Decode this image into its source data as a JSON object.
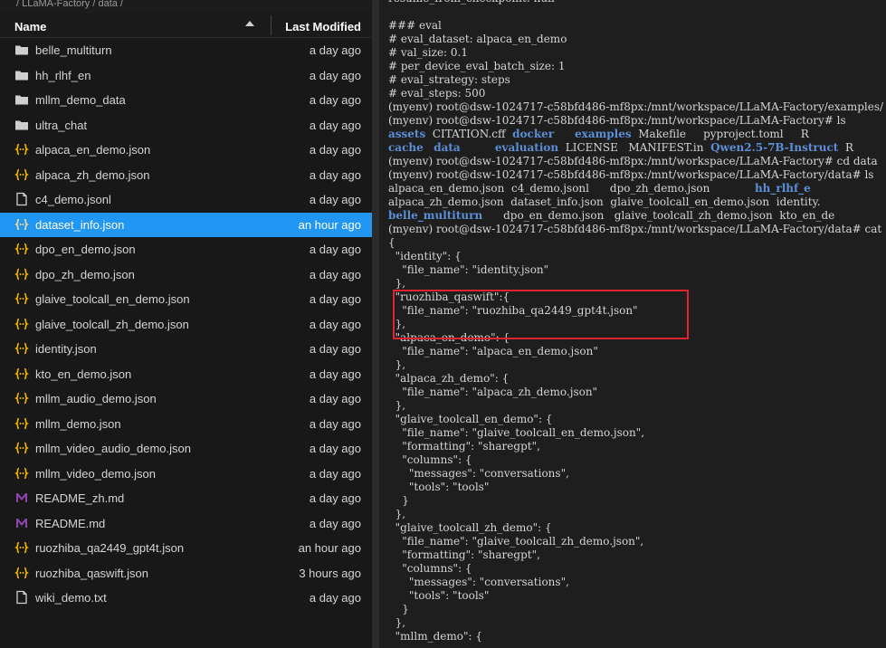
{
  "explorer": {
    "breadcrumb": "/ LLaMA-Factory / data /",
    "columns": {
      "name": "Name",
      "modified": "Last Modified"
    },
    "files": [
      {
        "name": "belle_multiturn",
        "modified": "a day ago",
        "icon": "folder-icon",
        "type": "folder"
      },
      {
        "name": "hh_rlhf_en",
        "modified": "a day ago",
        "icon": "folder-icon",
        "type": "folder"
      },
      {
        "name": "mllm_demo_data",
        "modified": "a day ago",
        "icon": "folder-icon",
        "type": "folder"
      },
      {
        "name": "ultra_chat",
        "modified": "a day ago",
        "icon": "folder-icon",
        "type": "folder"
      },
      {
        "name": "alpaca_en_demo.json",
        "modified": "a day ago",
        "icon": "json-icon",
        "type": "json"
      },
      {
        "name": "alpaca_zh_demo.json",
        "modified": "a day ago",
        "icon": "json-icon",
        "type": "json"
      },
      {
        "name": "c4_demo.jsonl",
        "modified": "a day ago",
        "icon": "file-icon",
        "type": "file"
      },
      {
        "name": "dataset_info.json",
        "modified": "an hour ago",
        "icon": "json-icon",
        "type": "json",
        "selected": true
      },
      {
        "name": "dpo_en_demo.json",
        "modified": "a day ago",
        "icon": "json-icon",
        "type": "json"
      },
      {
        "name": "dpo_zh_demo.json",
        "modified": "a day ago",
        "icon": "json-icon",
        "type": "json"
      },
      {
        "name": "glaive_toolcall_en_demo.json",
        "modified": "a day ago",
        "icon": "json-icon",
        "type": "json"
      },
      {
        "name": "glaive_toolcall_zh_demo.json",
        "modified": "a day ago",
        "icon": "json-icon",
        "type": "json"
      },
      {
        "name": "identity.json",
        "modified": "a day ago",
        "icon": "json-icon",
        "type": "json"
      },
      {
        "name": "kto_en_demo.json",
        "modified": "a day ago",
        "icon": "json-icon",
        "type": "json"
      },
      {
        "name": "mllm_audio_demo.json",
        "modified": "a day ago",
        "icon": "json-icon",
        "type": "json"
      },
      {
        "name": "mllm_demo.json",
        "modified": "a day ago",
        "icon": "json-icon",
        "type": "json"
      },
      {
        "name": "mllm_video_audio_demo.json",
        "modified": "a day ago",
        "icon": "json-icon",
        "type": "json"
      },
      {
        "name": "mllm_video_demo.json",
        "modified": "a day ago",
        "icon": "json-icon",
        "type": "json"
      },
      {
        "name": "README_zh.md",
        "modified": "a day ago",
        "icon": "markdown-icon",
        "type": "markdown"
      },
      {
        "name": "README.md",
        "modified": "a day ago",
        "icon": "markdown-icon",
        "type": "markdown"
      },
      {
        "name": "ruozhiba_qa2449_gpt4t.json",
        "modified": "an hour ago",
        "icon": "json-icon",
        "type": "json"
      },
      {
        "name": "ruozhiba_qaswift.json",
        "modified": "3 hours ago",
        "icon": "json-icon",
        "type": "json"
      },
      {
        "name": "wiki_demo.txt",
        "modified": "a day ago",
        "icon": "file-icon",
        "type": "file"
      }
    ]
  },
  "terminal": {
    "lines": [
      [
        {
          "t": "resume_from_checkpoint: null"
        }
      ],
      [
        {
          "t": ""
        }
      ],
      [
        {
          "t": "### eval"
        }
      ],
      [
        {
          "t": "# eval_dataset: alpaca_en_demo"
        }
      ],
      [
        {
          "t": "# val_size: 0.1"
        }
      ],
      [
        {
          "t": "# per_device_eval_batch_size: 1"
        }
      ],
      [
        {
          "t": "# eval_strategy: steps"
        }
      ],
      [
        {
          "t": "# eval_steps: 500"
        }
      ],
      [
        {
          "t": "(myenv) root@dsw-1024717-c58bfd486-mf8px:/mnt/workspace/LLaMA-Factory/examples/"
        }
      ],
      [
        {
          "t": "(myenv) root@dsw-1024717-c58bfd486-mf8px:/mnt/workspace/LLaMA-Factory# ls"
        }
      ],
      [
        {
          "t": "assets",
          "c": "blue"
        },
        {
          "t": "  CITATION.cff  "
        },
        {
          "t": "docker",
          "c": "blue"
        },
        {
          "t": "      "
        },
        {
          "t": "examples",
          "c": "blue"
        },
        {
          "t": "  Makefile     pyproject.toml     R"
        }
      ],
      [
        {
          "t": "cache",
          "c": "blue"
        },
        {
          "t": "   "
        },
        {
          "t": "data",
          "c": "blue"
        },
        {
          "t": "          "
        },
        {
          "t": "evaluation",
          "c": "blue"
        },
        {
          "t": "  LICENSE   MANIFEST.in  "
        },
        {
          "t": "Qwen2.5-7B-Instruct",
          "c": "blue"
        },
        {
          "t": "  R"
        }
      ],
      [
        {
          "t": "(myenv) root@dsw-1024717-c58bfd486-mf8px:/mnt/workspace/LLaMA-Factory# cd data"
        }
      ],
      [
        {
          "t": "(myenv) root@dsw-1024717-c58bfd486-mf8px:/mnt/workspace/LLaMA-Factory/data# ls"
        }
      ],
      [
        {
          "t": "alpaca_en_demo.json  c4_demo.jsonl      dpo_zh_demo.json             "
        },
        {
          "t": "hh_rlhf_e",
          "c": "blue"
        }
      ],
      [
        {
          "t": "alpaca_zh_demo.json  dataset_info.json  glaive_toolcall_en_demo.json  identity."
        }
      ],
      [
        {
          "t": "belle_multiturn",
          "c": "blue"
        },
        {
          "t": "      dpo_en_demo.json   glaive_toolcall_zh_demo.json  kto_en_de"
        }
      ],
      [
        {
          "t": "(myenv) root@dsw-1024717-c58bfd486-mf8px:/mnt/workspace/LLaMA-Factory/data# cat"
        }
      ],
      [
        {
          "t": "{"
        }
      ],
      [
        {
          "t": "  \"identity\": {"
        }
      ],
      [
        {
          "t": "    \"file_name\": \"identity.json\""
        }
      ],
      [
        {
          "t": "  },"
        }
      ],
      [
        {
          "t": "  \"ruozhiba_qaswift\":{"
        }
      ],
      [
        {
          "t": "    \"file_name\": \"ruozhiba_qa2449_gpt4t.json\""
        }
      ],
      [
        {
          "t": "  },"
        }
      ],
      [
        {
          "t": "  \"alpaca_en_demo\": {"
        }
      ],
      [
        {
          "t": "    \"file_name\": \"alpaca_en_demo.json\""
        }
      ],
      [
        {
          "t": "  },"
        }
      ],
      [
        {
          "t": "  \"alpaca_zh_demo\": {"
        }
      ],
      [
        {
          "t": "    \"file_name\": \"alpaca_zh_demo.json\""
        }
      ],
      [
        {
          "t": "  },"
        }
      ],
      [
        {
          "t": "  \"glaive_toolcall_en_demo\": {"
        }
      ],
      [
        {
          "t": "    \"file_name\": \"glaive_toolcall_en_demo.json\","
        }
      ],
      [
        {
          "t": "    \"formatting\": \"sharegpt\","
        }
      ],
      [
        {
          "t": "    \"columns\": {"
        }
      ],
      [
        {
          "t": "      \"messages\": \"conversations\","
        }
      ],
      [
        {
          "t": "      \"tools\": \"tools\""
        }
      ],
      [
        {
          "t": "    }"
        }
      ],
      [
        {
          "t": "  },"
        }
      ],
      [
        {
          "t": "  \"glaive_toolcall_zh_demo\": {"
        }
      ],
      [
        {
          "t": "    \"file_name\": \"glaive_toolcall_zh_demo.json\","
        }
      ],
      [
        {
          "t": "    \"formatting\": \"sharegpt\","
        }
      ],
      [
        {
          "t": "    \"columns\": {"
        }
      ],
      [
        {
          "t": "      \"messages\": \"conversations\","
        }
      ],
      [
        {
          "t": "      \"tools\": \"tools\""
        }
      ],
      [
        {
          "t": "    }"
        }
      ],
      [
        {
          "t": "  },"
        }
      ],
      [
        {
          "t": "  \"mllm_demo\": {"
        }
      ]
    ]
  },
  "colors": {
    "selected_row": "#2196f3",
    "folder": "#cfcfcf",
    "json": "#f5b700",
    "markdown": "#8e44ad",
    "terminal_dir": "#5c8fd6",
    "highlight": "#e0232e"
  }
}
